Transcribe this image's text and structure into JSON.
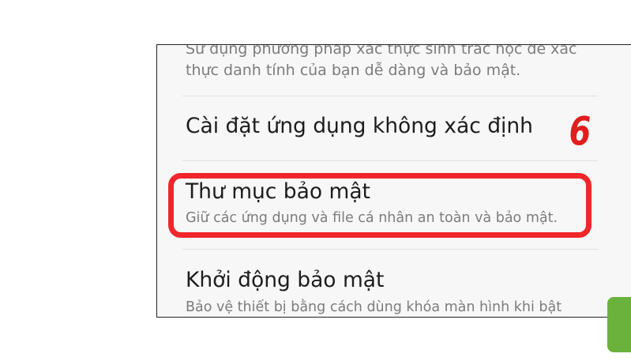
{
  "settings": {
    "biometric_desc": "Sử dụng phương pháp xác thực sinh trắc học để xác thực danh tính của bạn dễ dàng và bảo mật.",
    "unknown_apps_title": "Cài đặt ứng dụng không xác định",
    "secure_folder_title": "Thư mục bảo mật",
    "secure_folder_desc": "Giữ các ứng dụng và file cá nhân an toàn và bảo mật.",
    "secure_startup_title": "Khởi động bảo mật",
    "secure_startup_desc": "Bảo vệ thiết bị bằng cách dùng khóa màn hình khi bật"
  },
  "annotation": {
    "step_number": "6",
    "highlight_color": "#f0262b"
  },
  "colors": {
    "accent_green": "#6ab23c"
  }
}
